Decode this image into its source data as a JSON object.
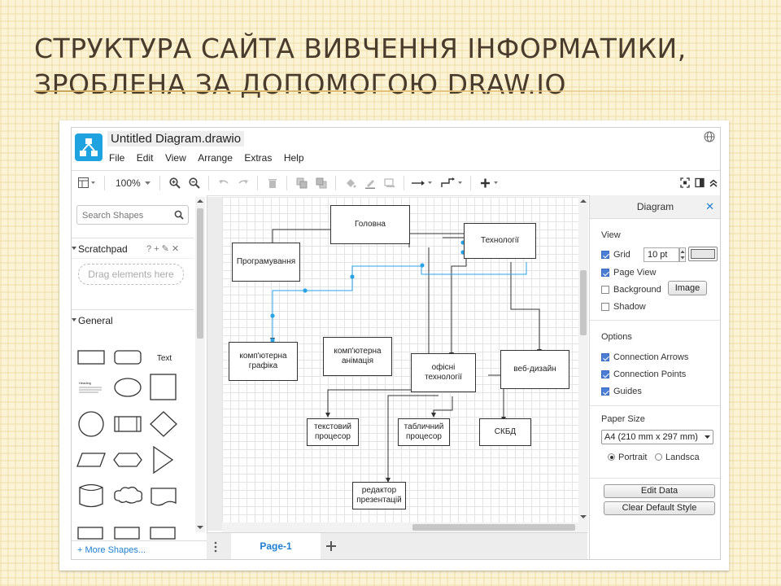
{
  "slide": {
    "title_line1": "СТРУКТУРА САЙТА ВИВЧЕННЯ ІНФОРМАТИКИ,",
    "title_line2": "ЗРОБЛЕНА ЗА ДОПОМОГОЮ DRAW.IO"
  },
  "app": {
    "file_title": "Untitled Diagram.drawio",
    "menu": [
      "File",
      "Edit",
      "View",
      "Arrange",
      "Extras",
      "Help"
    ],
    "toolbar": {
      "zoom": "100%"
    }
  },
  "sidebar": {
    "search_placeholder": "Search Shapes",
    "scratchpad": "Scratchpad",
    "scratchpad_tools": "? + ✎ ✕",
    "drop_hint": "Drag elements here",
    "general": "General",
    "text_shape": "Text",
    "heading_shape": "Heading",
    "more_shapes": "+ More Shapes..."
  },
  "diagram": {
    "nodes": {
      "holovna": "Головна",
      "tekhnolohii": "Технології",
      "prohramuvannia": "Програмування",
      "grafika": "комп'ютерна\nграфіка",
      "animatsiia": "комп'ютерна\nанімація",
      "ofisni": "офісні\nтехнології",
      "vebdyzain": "веб-дизайн",
      "tekstovyi": "текстовий\nпроцесор",
      "tablychnyi": "табличний\nпроцесор",
      "skbd": "СКБД",
      "redaktor": "редактор\nпрезентацій"
    }
  },
  "pages": {
    "current": "Page-1"
  },
  "format": {
    "title": "Diagram",
    "view_heading": "View",
    "grid": "Grid",
    "grid_size": "10 pt",
    "page_view": "Page View",
    "background": "Background",
    "image_btn": "Image",
    "shadow": "Shadow",
    "options_heading": "Options",
    "connection_arrows": "Connection Arrows",
    "connection_points": "Connection Points",
    "guides": "Guides",
    "paper_heading": "Paper Size",
    "paper_value": "A4 (210 mm x 297 mm)",
    "portrait": "Portrait",
    "landscape": "Landsca",
    "edit_data": "Edit Data",
    "clear_style": "Clear Default Style"
  },
  "colors": {
    "accent": "#1ea3e0",
    "link": "#1e7fd0",
    "selection": "#29a3e6"
  }
}
